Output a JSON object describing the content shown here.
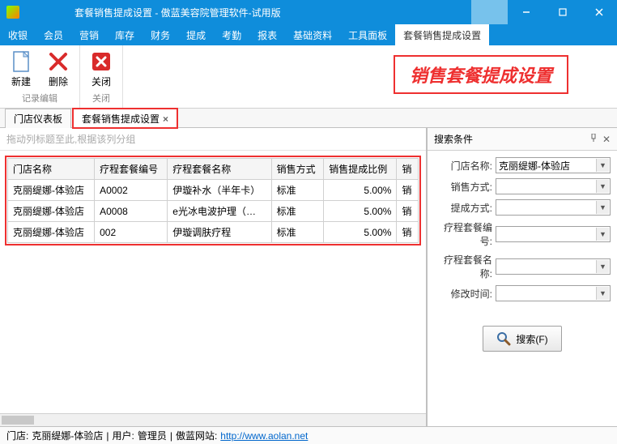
{
  "title": "套餐销售提成设置 - 傲蓝美容院管理软件-试用版",
  "menus": [
    "收银",
    "会员",
    "营销",
    "库存",
    "财务",
    "提成",
    "考勤",
    "报表",
    "基础资料",
    "工具面板",
    "套餐销售提成设置"
  ],
  "active_menu": 10,
  "ribbon": {
    "groups": [
      {
        "label": "记录编辑",
        "buttons": [
          {
            "name": "new",
            "label": "新建"
          },
          {
            "name": "delete",
            "label": "删除"
          }
        ]
      },
      {
        "label": "关闭",
        "buttons": [
          {
            "name": "close",
            "label": "关闭"
          }
        ]
      }
    ],
    "banner": "销售套餐提成设置"
  },
  "tabs": [
    {
      "label": "门店仪表板",
      "closable": false,
      "active": false,
      "hl": false
    },
    {
      "label": "套餐销售提成设置",
      "closable": true,
      "active": true,
      "hl": true
    }
  ],
  "group_hint": "拖动列标题至此,根据该列分组",
  "grid": {
    "cols": [
      "门店名称",
      "疗程套餐编号",
      "疗程套餐名称",
      "销售方式",
      "销售提成比例",
      "销"
    ],
    "rows": [
      [
        "克丽缇娜-体验店",
        "A0002",
        "伊璇补水（半年卡）",
        "标准",
        "5.00%",
        "销"
      ],
      [
        "克丽缇娜-体验店",
        "A0008",
        "e光冰电波护理（…",
        "标准",
        "5.00%",
        "销"
      ],
      [
        "克丽缇娜-体验店",
        "002",
        "伊璇调肤疗程",
        "标准",
        "5.00%",
        "销"
      ]
    ]
  },
  "side": {
    "title": "搜索条件",
    "fields": [
      {
        "label": "门店名称:",
        "value": "克丽缇娜-体验店"
      },
      {
        "label": "销售方式:",
        "value": ""
      },
      {
        "label": "提成方式:",
        "value": ""
      },
      {
        "label": "疗程套餐编号:",
        "value": ""
      },
      {
        "label": "疗程套餐名称:",
        "value": ""
      },
      {
        "label": "修改时间:",
        "value": ""
      }
    ],
    "search_btn": "搜索(F)"
  },
  "status": {
    "store_label": "门店: ",
    "store": "克丽缇娜-体验店",
    "user_label": "用户: ",
    "user": "管理员",
    "site_label": "傲蓝网站: ",
    "site_url": "http://www.aolan.net"
  }
}
